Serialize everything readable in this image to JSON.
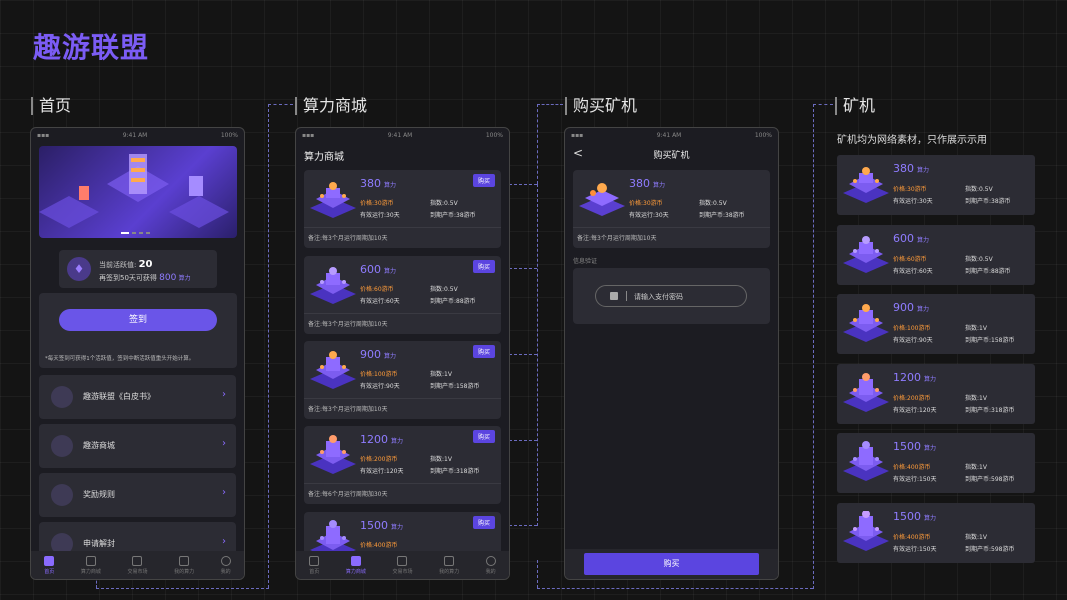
{
  "logo": "趣游联盟",
  "sections": {
    "home": "首页",
    "store": "算力商城",
    "buy": "购买矿机",
    "miner": "矿机"
  },
  "miner_note": "矿机均为网络素材，只作展示示用",
  "status_bar": {
    "time": "9:41 AM",
    "battery": "100%"
  },
  "home": {
    "active_label": "当前活跃值:",
    "active_value": "20",
    "signin_hint": "再签到50天可获得",
    "signin_reward": "800",
    "signin_reward_unit": "算力",
    "signin_button": "签到",
    "rule_note": "*每天签到可获得1个活跃值，签到中断活跃值重头开始计算。",
    "menu": [
      "趣游联盟《白皮书》",
      "趣游商城",
      "奖励规则",
      "申请解封"
    ]
  },
  "tabs": [
    "首页",
    "算力商城",
    "交易市场",
    "我的算力",
    "我的"
  ],
  "store": {
    "title": "算力商城",
    "buy_label": "购买",
    "unit": "算力",
    "cards": [
      {
        "value": "380",
        "price": "价格:30游币",
        "days": "有效运行:30天",
        "index": "指数:0.5V",
        "yield": "到期产币:38游币",
        "note": "备注:每3个月运行周期加10天"
      },
      {
        "value": "600",
        "price": "价格:60游币",
        "days": "有效运行:60天",
        "index": "指数:0.5V",
        "yield": "到期产币:88游币",
        "note": "备注:每3个月运行周期加10天"
      },
      {
        "value": "900",
        "price": "价格:100游币",
        "days": "有效运行:90天",
        "index": "指数:1V",
        "yield": "到期产币:158游币",
        "note": "备注:每3个月运行周期加10天"
      },
      {
        "value": "1200",
        "price": "价格:200游币",
        "days": "有效运行:120天",
        "index": "指数:1V",
        "yield": "到期产币:318游币",
        "note": "备注:每6个月运行周期加30天"
      },
      {
        "value": "1500",
        "price": "价格:400游币",
        "days": "",
        "index": "",
        "yield": "",
        "note": ""
      }
    ]
  },
  "buy": {
    "title": "购买矿机",
    "back": "<",
    "card": {
      "value": "380",
      "price": "价格:30游币",
      "days": "有效运行:30天",
      "index": "指数:0.5V",
      "yield": "到期产币:38游币",
      "note": "备注:每3个月运行周期加10天"
    },
    "verify_label": "信息验证",
    "password_placeholder": "请输入支付密码",
    "buy_button": "购买"
  },
  "miners": [
    {
      "value": "380",
      "price": "价格:30游币",
      "days": "有效运行:30天",
      "index": "指数:0.5V",
      "yield": "到期产币:38游币"
    },
    {
      "value": "600",
      "price": "价格:60游币",
      "days": "有效运行:60天",
      "index": "指数:0.5V",
      "yield": "到期产币:88游币"
    },
    {
      "value": "900",
      "price": "价格:100游币",
      "days": "有效运行:90天",
      "index": "指数:1V",
      "yield": "到期产币:158游币"
    },
    {
      "value": "1200",
      "price": "价格:200游币",
      "days": "有效运行:120天",
      "index": "指数:1V",
      "yield": "到期产币:318游币"
    },
    {
      "value": "1500",
      "price": "价格:400游币",
      "days": "有效运行:150天",
      "index": "指数:1V",
      "yield": "到期产币:598游币"
    },
    {
      "value": "1500",
      "price": "价格:400游币",
      "days": "有效运行:150天",
      "index": "指数:1V",
      "yield": "到期产币:598游币"
    }
  ],
  "colors": {
    "accent": "#5b45e0",
    "value": "#8f7cff",
    "price": "#ff9c3a",
    "bg": "#141414",
    "card": "#2c2c34"
  }
}
